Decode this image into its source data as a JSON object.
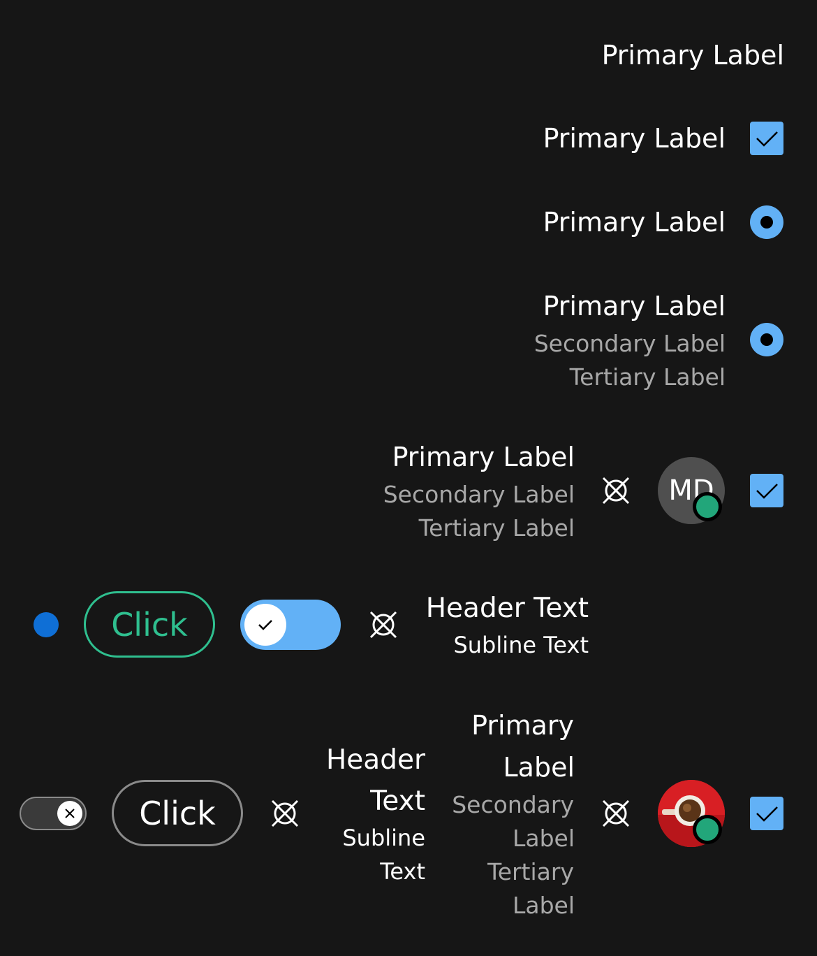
{
  "colors": {
    "background": "#161616",
    "accent_blue": "#62b1f6",
    "dot_blue": "#0f6fd6",
    "green": "#22a67a",
    "green_button": "#2fbf8f",
    "secondary_text": "#a8a8a8"
  },
  "row1": {
    "primary": "Primary Label"
  },
  "row2": {
    "primary": "Primary Label",
    "checked": true
  },
  "row3": {
    "primary": "Primary Label",
    "selected": true
  },
  "row4": {
    "primary": "Primary Label",
    "secondary": "Secondary Label",
    "tertiary": "Tertiary Label",
    "selected": true
  },
  "row5": {
    "primary": "Primary Label",
    "secondary": "Secondary Label",
    "tertiary": "Tertiary Label",
    "avatar_initials": "MD",
    "checked": true
  },
  "row6": {
    "button": "Click",
    "toggle_on": true,
    "header": "Header Text",
    "subline": "Subline Text"
  },
  "row7": {
    "button": "Click",
    "header_1": "Header",
    "header_2": "Text",
    "subline_1": "Subline",
    "subline_2": "Text",
    "primary_1": "Primary",
    "primary_2": "Label",
    "secondary_1": "Secondary",
    "secondary_2": "Label",
    "tertiary_1": "Tertiary",
    "tertiary_2": "Label",
    "toggle_on": false,
    "checked": true,
    "avatar_image": "coffee-cup-photo"
  }
}
